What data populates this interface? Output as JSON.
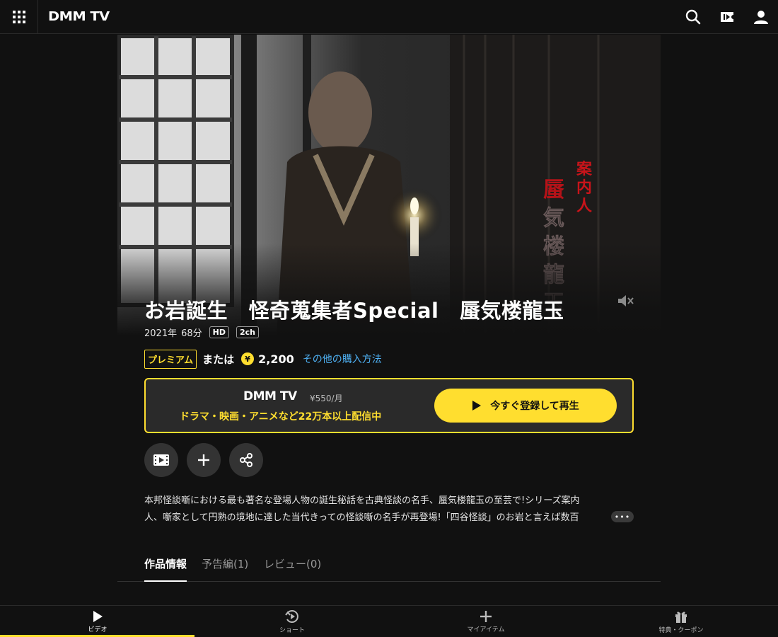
{
  "header": {
    "logo": "DMM TV"
  },
  "hero": {
    "overlay_vertical_text": [
      "案",
      "内",
      "人",
      "蜃",
      "気",
      "楼",
      "龍",
      "玉"
    ]
  },
  "title": "お岩誕生　怪奇蒐集者Special　蜃気楼龍玉",
  "meta": {
    "year": "2021年",
    "duration": "68分",
    "badges": [
      "HD",
      "2ch"
    ]
  },
  "pricing": {
    "premium_label": "プレミアム",
    "or_text": "または",
    "coin_symbol": "¥",
    "price": "2,200",
    "other_methods_link": "その他の購入方法"
  },
  "promo": {
    "logo": "DMM TV",
    "monthly_price": "¥550/月",
    "copy": "ドラマ・映画・アニメなど22万本以上配信中",
    "cta_label": "今すぐ登録して再生"
  },
  "description": {
    "line1": "本邦怪談噺における最も著名な登場人物の誕生秘話を古典怪談の名手、蜃気楼龍玉の至芸で!シリーズ案内",
    "line2": "人、噺家として円熟の境地に達した当代きっての怪談噺の名手が再登場!「四谷怪談」のお岩と言えば数百",
    "more_label": "•••"
  },
  "tabs": [
    {
      "label": "作品情報"
    },
    {
      "label": "予告編(1)"
    },
    {
      "label": "レビュー(0)"
    }
  ],
  "bottom_nav": [
    {
      "label": "ビデオ"
    },
    {
      "label": "ショート"
    },
    {
      "label": "マイアイテム"
    },
    {
      "label": "特典・クーポン"
    }
  ],
  "colors": {
    "accent": "#ffde2f",
    "link": "#4fb2f5",
    "background": "#111111"
  }
}
